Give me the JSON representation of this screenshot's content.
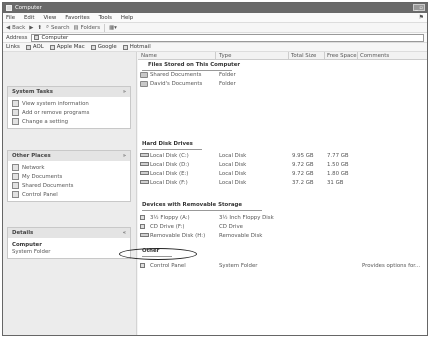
{
  "window": {
    "title": "Computer"
  },
  "menu": {
    "items": [
      "File",
      "Edit",
      "View",
      "Favorites",
      "Tools",
      "Help"
    ]
  },
  "toolbar": {
    "back": "Back",
    "search": "Search",
    "folders": "Folders"
  },
  "address": {
    "label": "Address",
    "value": "Computer"
  },
  "links": {
    "label": "Links",
    "items": [
      "AOL",
      "Apple Mac",
      "Google",
      "Hotmail"
    ]
  },
  "sidebar": {
    "system_tasks": {
      "title": "System Tasks",
      "items": [
        "View system information",
        "Add or remove programs",
        "Change a setting"
      ]
    },
    "other_places": {
      "title": "Other Places",
      "items": [
        "Network",
        "My Documents",
        "Shared Documents",
        "Control Panel"
      ]
    },
    "details": {
      "title": "Details",
      "name": "Computer",
      "type": "System Folder"
    }
  },
  "columns": {
    "name": "Name",
    "type": "Type",
    "total_size": "Total Size",
    "free_space": "Free Space",
    "comments": "Comments"
  },
  "groups": {
    "files": "Files Stored on This Computer",
    "hdd": "Hard Disk Drives",
    "removable": "Devices with Removable Storage",
    "other": "Other"
  },
  "rows": {
    "files": [
      {
        "name": "Shared Documents",
        "type": "Folder"
      },
      {
        "name": "David's Documents",
        "type": "Folder"
      }
    ],
    "hdd": [
      {
        "name": "Local Disk (C:)",
        "type": "Local Disk",
        "total": "9.95 GB",
        "free": "7.77 GB"
      },
      {
        "name": "Local Disk (D:)",
        "type": "Local Disk",
        "total": "9.72 GB",
        "free": "1.50 GB"
      },
      {
        "name": "Local Disk (E:)",
        "type": "Local Disk",
        "total": "9.72 GB",
        "free": "1.80 GB"
      },
      {
        "name": "Local Disk (F:)",
        "type": "Local Disk",
        "total": "37.2 GB",
        "free": "31 GB"
      }
    ],
    "removable": [
      {
        "name": "3½ Floppy (A:)",
        "type": "3½ Inch Floppy Disk"
      },
      {
        "name": "CD Drive (F:)",
        "type": "CD Drive"
      },
      {
        "name": "Removable Disk (H:)",
        "type": "Removable Disk"
      }
    ],
    "other": [
      {
        "name": "Control Panel",
        "type": "System Folder",
        "comment": "Provides options for..."
      }
    ]
  }
}
